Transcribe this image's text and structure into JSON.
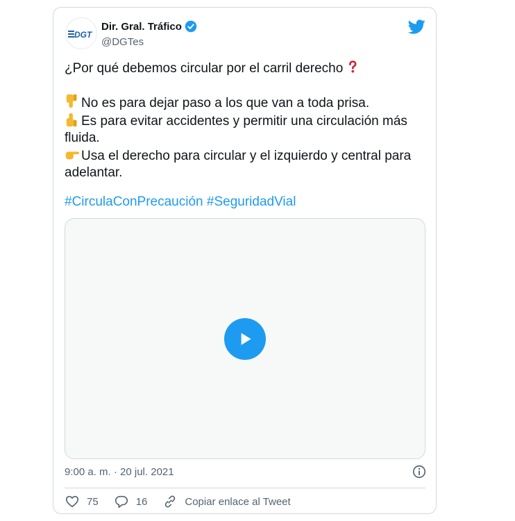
{
  "tweet": {
    "author": {
      "name": "Dir. Gral. Tráfico",
      "handle": "@DGTes",
      "logo_text": "DGT"
    },
    "lines": {
      "question": "¿Por qué debemos circular por el carril derecho",
      "line1": "No es para dejar paso a los que van a toda prisa.",
      "line2": "Es para evitar accidentes y permitir una circulación más fluida.",
      "line3": "Usa el derecho para circular y el izquierdo y central para adelantar."
    },
    "hashtags": [
      "#CirculaConPrecaución",
      "#SeguridadVial"
    ],
    "timestamp": "9:00 a. m. · 20 jul. 2021",
    "likes": "75",
    "replies": "16",
    "copy_link": "Copiar enlace al Tweet"
  },
  "colors": {
    "accent": "#1d9bf0",
    "muted": "#536471",
    "border": "#cfd9de",
    "emoji_yellow": "#f5b82e",
    "question_red": "#d1263b"
  },
  "icons": [
    "dgt-logo-icon",
    "verified-badge-icon",
    "twitter-bird-icon",
    "red-question-mark-icon",
    "thumbs-down-icon",
    "thumbs-up-icon",
    "pointing-right-icon",
    "play-icon",
    "info-icon",
    "heart-icon",
    "reply-icon",
    "link-icon"
  ]
}
